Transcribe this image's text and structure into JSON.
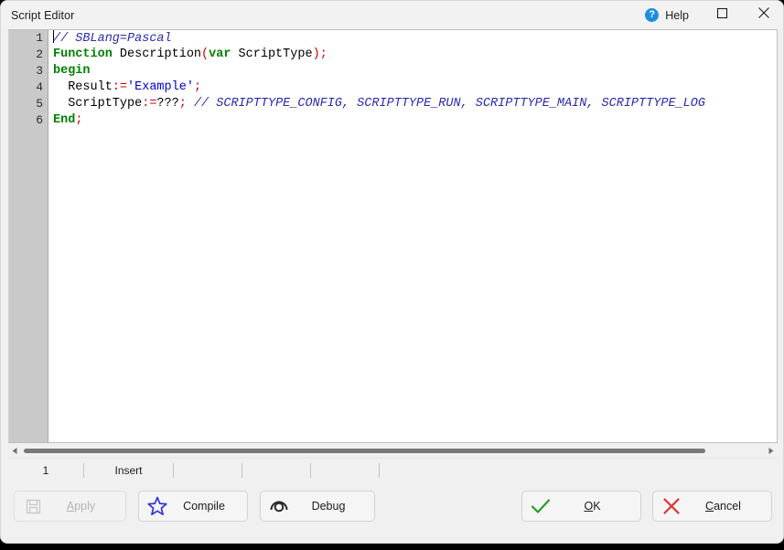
{
  "window": {
    "title": "Script Editor"
  },
  "titlebar": {
    "help_label": "Help",
    "help_icon": "question-mark-circle-icon",
    "question_glyph": "?",
    "maximize_icon": "maximize-icon",
    "close_icon": "close-icon"
  },
  "editor": {
    "gutter_numbers": [
      "1",
      "2",
      "3",
      "4",
      "5",
      "6"
    ],
    "lines": [
      {
        "number": "1",
        "text": "// SBLang=Pascal",
        "tokens": [
          {
            "t": "// SBLang=Pascal",
            "k": "cmt"
          }
        ]
      },
      {
        "number": "2",
        "text": "Function Description(var ScriptType);",
        "tokens": [
          {
            "t": "Function",
            "k": "kw"
          },
          {
            "t": " Description",
            "k": "id"
          },
          {
            "t": "(",
            "k": "sym"
          },
          {
            "t": "var",
            "k": "kw"
          },
          {
            "t": " ScriptType",
            "k": "id"
          },
          {
            "t": ")",
            "k": "sym"
          },
          {
            "t": ";",
            "k": "sym"
          }
        ]
      },
      {
        "number": "3",
        "text": "begin",
        "tokens": [
          {
            "t": "begin",
            "k": "kw"
          }
        ]
      },
      {
        "number": "4",
        "text": "  Result:='Example';",
        "tokens": [
          {
            "t": "  Result",
            "k": "id"
          },
          {
            "t": ":=",
            "k": "sym"
          },
          {
            "t": "'Example'",
            "k": "str"
          },
          {
            "t": ";",
            "k": "sym"
          }
        ]
      },
      {
        "number": "5",
        "text": "  ScriptType:=???; // SCRIPTTYPE_CONFIG, SCRIPTTYPE_RUN, SCRIPTTYPE_MAIN, SCRIPTTYPE_LOG",
        "tokens": [
          {
            "t": "  ScriptType",
            "k": "id"
          },
          {
            "t": ":=",
            "k": "sym"
          },
          {
            "t": "???",
            "k": "id"
          },
          {
            "t": ";",
            "k": "sym"
          },
          {
            "t": " ",
            "k": "id"
          },
          {
            "t": "// SCRIPTTYPE_CONFIG, SCRIPTTYPE_RUN, SCRIPTTYPE_MAIN, SCRIPTTYPE_LOG",
            "k": "cmt"
          }
        ]
      },
      {
        "number": "6",
        "text": "End;",
        "tokens": [
          {
            "t": "End",
            "k": "kw"
          },
          {
            "t": ";",
            "k": "sym"
          }
        ]
      }
    ]
  },
  "scrollbar": {
    "left_arrow_icon": "triangle-left-icon",
    "right_arrow_icon": "triangle-right-icon"
  },
  "statusbar": {
    "line_number": "1",
    "insert_mode": "Insert",
    "panel_3": "",
    "panel_4": "",
    "panel_5": "",
    "panel_6": ""
  },
  "buttons": {
    "apply": {
      "label": "Apply",
      "icon": "save-floppy-icon",
      "enabled": false,
      "accel": "A"
    },
    "compile": {
      "label": "Compile",
      "icon": "star-icon",
      "enabled": true,
      "accel": ""
    },
    "debug": {
      "label": "Debug",
      "icon": "eye-icon",
      "enabled": true,
      "accel": ""
    },
    "ok": {
      "label": "OK",
      "icon": "check-icon",
      "enabled": true,
      "accel": "O"
    },
    "cancel": {
      "label": "Cancel",
      "icon": "cross-icon",
      "enabled": true,
      "accel": "C"
    }
  },
  "colors": {
    "keyword": "#008000",
    "symbol": "#d00000",
    "string": "#0000d0",
    "comment": "#2a2ab0",
    "help_blue": "#1a8fe0",
    "compile_star": "#3333dd",
    "ok_check": "#2a9a2a",
    "cancel_cross": "#dd3333",
    "gutter": "#c9c9c9"
  }
}
